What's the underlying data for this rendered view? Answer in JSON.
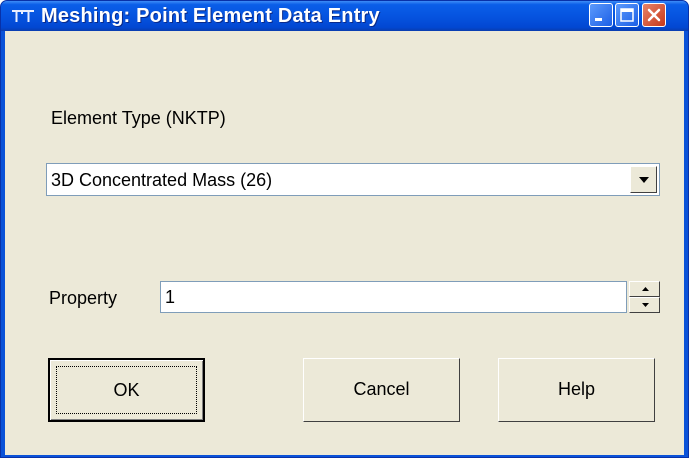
{
  "window": {
    "title": "Meshing: Point Element Data Entry",
    "icon": "app-logo-icon",
    "controls": [
      "minimize-icon",
      "maximize-icon",
      "close-icon"
    ]
  },
  "element_type": {
    "label": "Element Type (NKTP)",
    "selected": "3D Concentrated Mass (26)"
  },
  "property": {
    "label": "Property",
    "value": "1"
  },
  "buttons": {
    "ok": "OK",
    "cancel": "Cancel",
    "help": "Help"
  },
  "colors": {
    "title_bar": "#0654e0",
    "client_bg": "#ece9d8",
    "close_button": "#c6391a"
  }
}
